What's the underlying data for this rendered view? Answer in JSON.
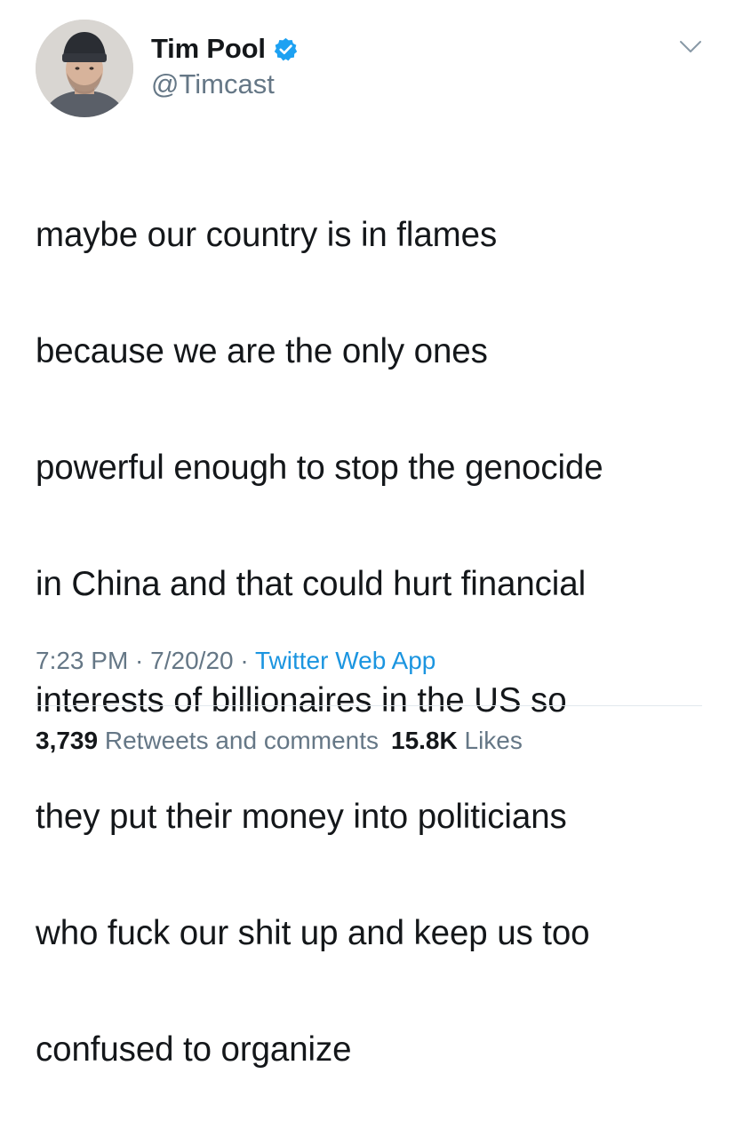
{
  "author": {
    "display_name": "Tim Pool",
    "handle": "@Timcast",
    "verified": true,
    "avatar_icon": "profile-photo"
  },
  "tweet": {
    "lines": [
      "maybe our country is in flames",
      "because we are the only ones",
      "powerful enough to stop the genocide",
      "in China and that could hurt financial",
      "interests of billionaires in the US so",
      "they put their money into politicians",
      "who fuck our shit up and keep us too",
      "confused to organize"
    ]
  },
  "meta": {
    "time": "7:23 PM",
    "separator": " · ",
    "date": "7/20/20",
    "source": "Twitter Web App"
  },
  "stats": {
    "retweets_count": "3,739",
    "retweets_label": "Retweets and comments",
    "likes_count": "15.8K",
    "likes_label": "Likes"
  },
  "colors": {
    "text": "#14171a",
    "secondary": "#657786",
    "link": "#1b95e0",
    "verified": "#1da1f2",
    "divider": "#e1e8ed"
  }
}
